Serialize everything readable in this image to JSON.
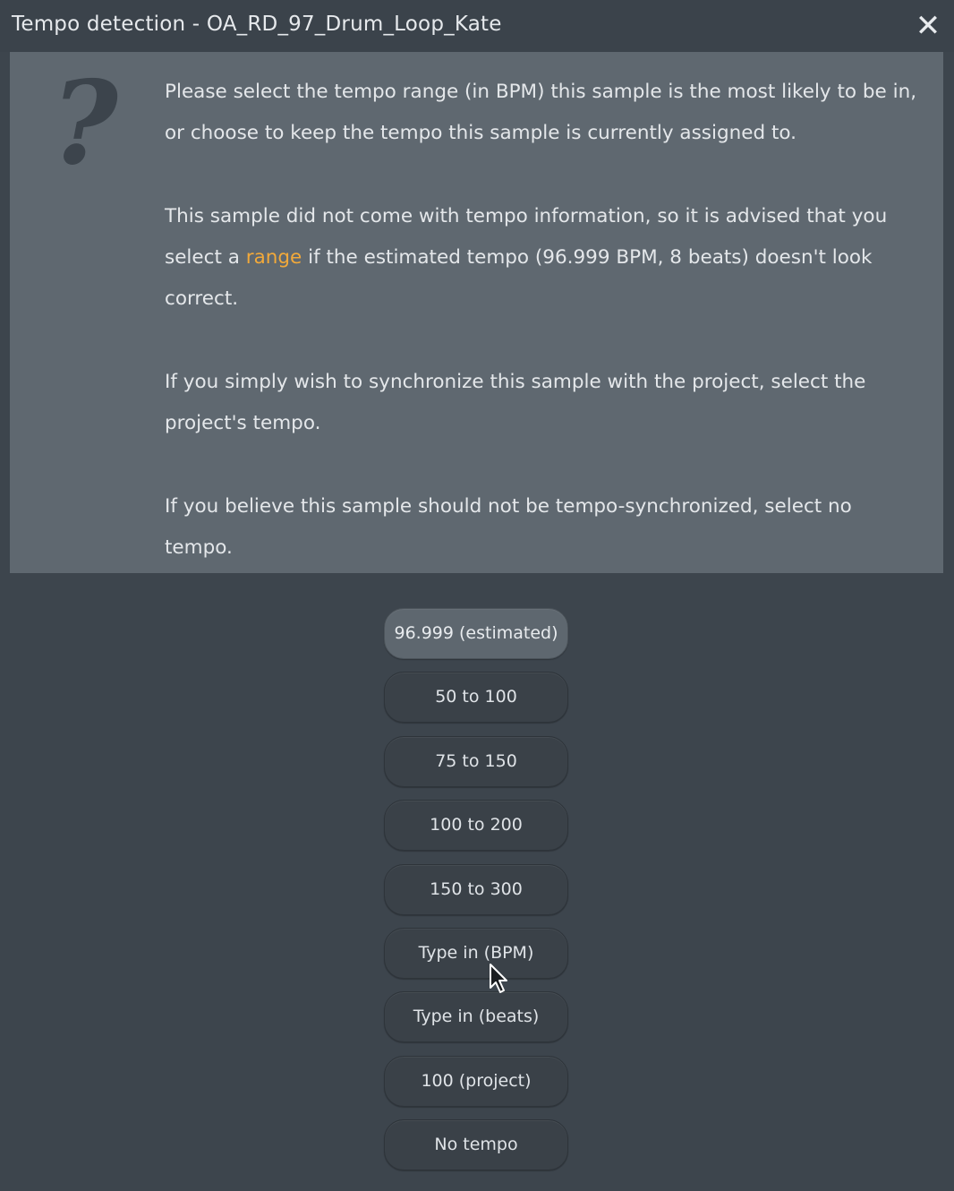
{
  "window": {
    "title": "Tempo detection - OA_RD_97_Drum_Loop_Kate",
    "close_glyph": "✕"
  },
  "message": {
    "icon": "question-mark-icon",
    "icon_glyph": "?",
    "paragraph1": "Please select the tempo range (in BPM) this sample is the most likely to be in, or choose to keep the tempo this sample is currently assigned to.",
    "paragraph2_before": "This sample did not come with tempo information, so it is advised that you select a ",
    "paragraph2_highlight": "range",
    "paragraph2_after": " if the estimated tempo (96.999 BPM, 8 beats) doesn't look correct.",
    "paragraph3": "If you simply wish to synchronize this sample with the project, select the project's tempo.",
    "paragraph4": "If you believe this sample should not be tempo-synchronized, select no tempo."
  },
  "buttons": [
    {
      "label": "96.999 (estimated)",
      "default": true
    },
    {
      "label": "50 to 100"
    },
    {
      "label": "75 to 150"
    },
    {
      "label": "100 to 200"
    },
    {
      "label": "150 to 300"
    },
    {
      "label": "Type in (BPM)"
    },
    {
      "label": "Type in (beats)"
    },
    {
      "label": "100 (project)"
    },
    {
      "label": "No tempo"
    }
  ],
  "colors": {
    "highlight": "#f2a93a",
    "panel": "#5f6870",
    "background": "#3d454d"
  }
}
